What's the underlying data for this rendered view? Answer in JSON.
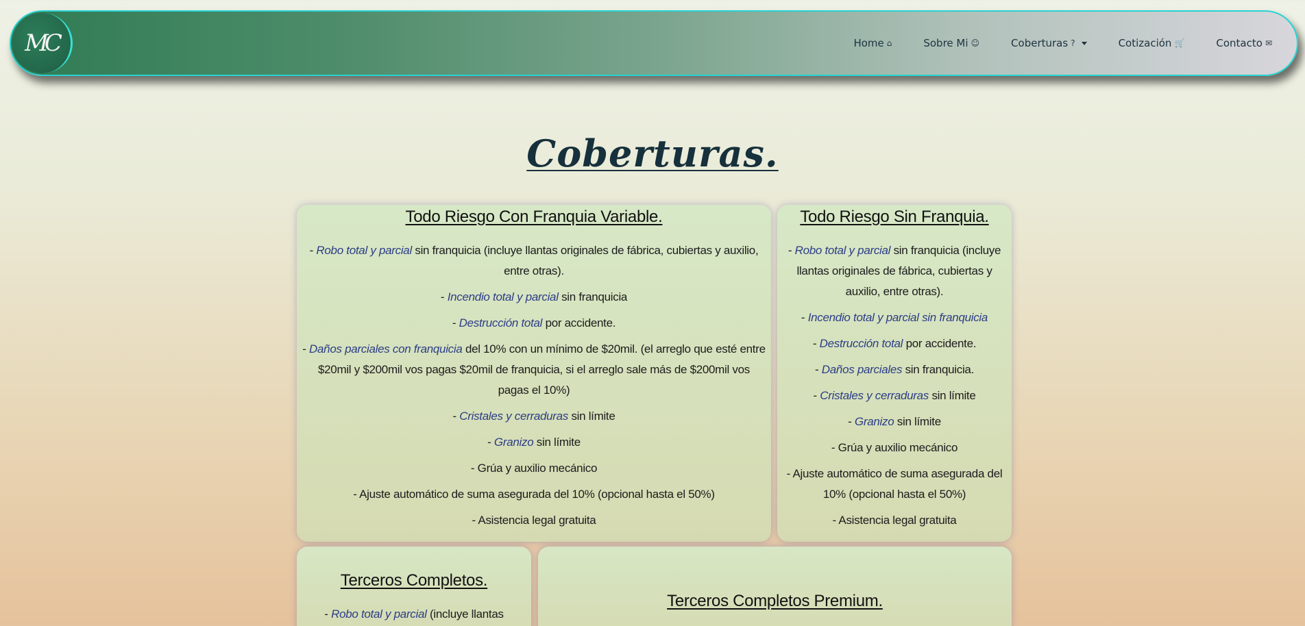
{
  "nav": {
    "logo_text": "MC",
    "items": [
      {
        "label": "Home",
        "icon": "⌂",
        "icon_name": "house-icon"
      },
      {
        "label": "Sobre Mi",
        "icon": "☺",
        "icon_name": "smile-icon"
      },
      {
        "label": "Coberturas",
        "icon": "?",
        "icon_name": "question-circle-icon"
      },
      {
        "label": "Cotización",
        "icon": "🛒",
        "icon_name": "cart-icon"
      },
      {
        "label": "Contacto",
        "icon": "✉",
        "icon_name": "envelope-icon"
      }
    ]
  },
  "page": {
    "title": "Coberturas."
  },
  "cards": [
    {
      "title": "Todo Riesgo Con Franquia Variable.",
      "items": [
        {
          "em": "Robo total y parcial",
          "text": " sin franquicia (incluye llantas originales de fábrica, cubiertas y auxilio, entre otras)."
        },
        {
          "em": "Incendio total y parcial",
          "text": " sin franquicia"
        },
        {
          "em": "Destrucción total",
          "text": " por accidente."
        },
        {
          "em": "Daños parciales con franquicia",
          "text": " del 10% con un mínimo de $20mil. (el arreglo que esté entre $20mil y $200mil vos pagas $20mil de franquicia, si el arreglo sale más de $200mil vos pagas el 10%)"
        },
        {
          "em": "Cristales y cerraduras",
          "text": " sin límite"
        },
        {
          "em": "Granizo",
          "text": " sin límite"
        },
        {
          "em": "",
          "text": "Grúa y auxilio mecánico"
        },
        {
          "em": "",
          "text": "Ajuste automático de suma asegurada del 10% (opcional hasta el 50%)"
        },
        {
          "em": "",
          "text": "Asistencia legal gratuita"
        }
      ]
    },
    {
      "title": "Todo Riesgo Sin Franquia.",
      "items": [
        {
          "em": "Robo total y parcial",
          "text": " sin franquicia (incluye llantas originales de fábrica, cubiertas y auxilio, entre otras)."
        },
        {
          "em": "Incendio total y parcial sin franquicia",
          "text": ""
        },
        {
          "em": "Destrucción total",
          "text": " por accidente."
        },
        {
          "em": "Daños parciales",
          "text": " sin franquicia."
        },
        {
          "em": "Cristales y cerraduras",
          "text": " sin límite"
        },
        {
          "em": "Granizo",
          "text": " sin límite"
        },
        {
          "em": "",
          "text": "Grúa y auxilio mecánico"
        },
        {
          "em": "",
          "text": "Ajuste automático de suma asegurada del 10% (opcional hasta el 50%)"
        },
        {
          "em": "",
          "text": "Asistencia legal gratuita"
        }
      ]
    },
    {
      "title": "Terceros Completos.",
      "items": [
        {
          "em": "Robo total y parcial",
          "text": " (incluye llantas originales"
        }
      ]
    },
    {
      "title": "Terceros Completos Premium.",
      "items": []
    }
  ]
}
